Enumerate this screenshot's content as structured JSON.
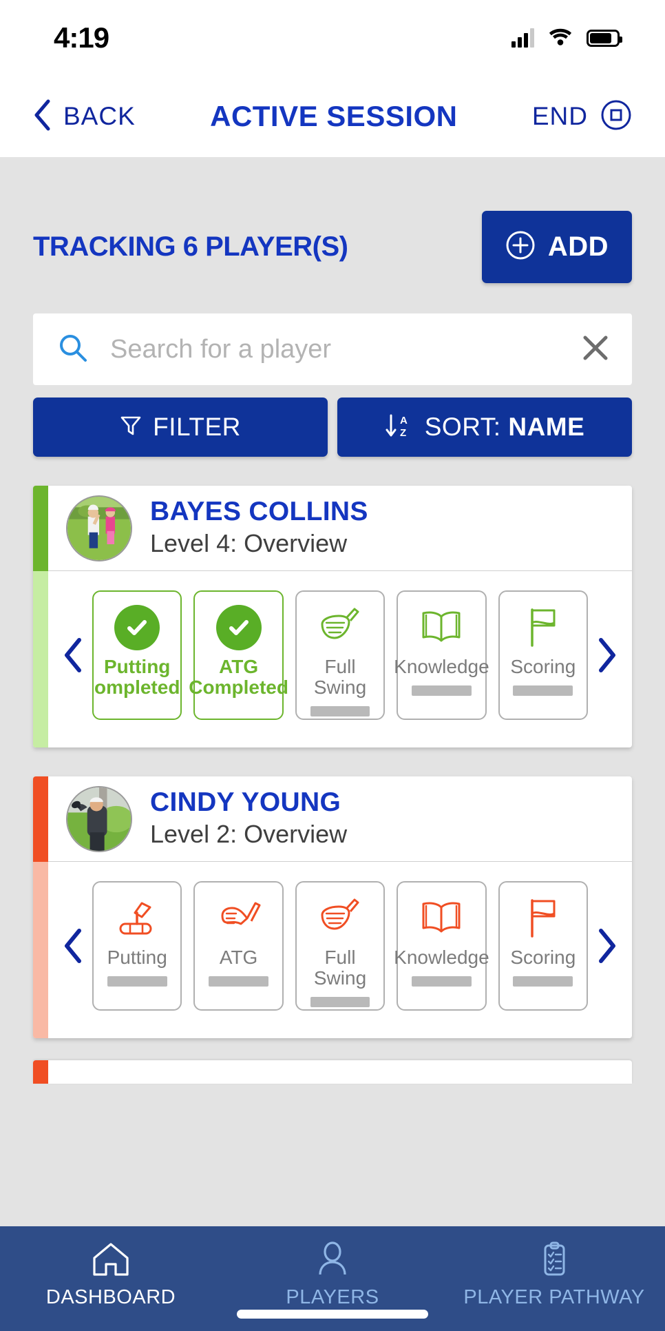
{
  "status_bar": {
    "time": "4:19",
    "signal_icon": "cellular-signal-icon",
    "wifi_icon": "wifi-icon",
    "battery_icon": "battery-icon"
  },
  "header": {
    "back_label": "BACK",
    "back_icon": "chevron-left-icon",
    "title": "ACTIVE SESSION",
    "end_label": "END",
    "end_icon": "stop-session-icon"
  },
  "tracking": {
    "title": "TRACKING 6 PLAYER(S)",
    "player_count": 6,
    "add_label": "ADD",
    "add_icon": "plus-circle-icon"
  },
  "search": {
    "placeholder": "Search for a player",
    "value": "",
    "search_icon": "search-icon",
    "clear_icon": "close-icon"
  },
  "controls": {
    "filter_label": "FILTER",
    "filter_icon": "funnel-icon",
    "sort_prefix": "SORT: ",
    "sort_value": "NAME",
    "sort_icon": "sort-az-icon"
  },
  "nav_arrows": {
    "prev_icon": "chevron-left-icon",
    "next_icon": "chevron-right-icon"
  },
  "colors": {
    "brand_blue": "#0f3399",
    "title_blue": "#1436c0",
    "green": "#6cb52d",
    "orange": "#f04e23",
    "nav_bar": "#2f4d88",
    "page_bg": "#e3e3e3"
  },
  "players": [
    {
      "name": "BAYES COLLINS",
      "level": "Level 4: Overview",
      "accent": "green",
      "accent_color": "#6cb52d",
      "accent_light": "#c6eda3",
      "avatar": "player-photo-bayes-collins",
      "skills": [
        {
          "label": "Putting\nompleted",
          "label_line1": "Putting",
          "label_line2": "ompleted",
          "icon": "check-circle-icon",
          "state": "completed"
        },
        {
          "label": "ATG\nCompleted",
          "label_line1": "ATG",
          "label_line2": "Completed",
          "icon": "check-circle-icon",
          "state": "completed"
        },
        {
          "label": "Full Swing",
          "label_line1": "Full Swing",
          "label_line2": "",
          "icon": "driver-icon",
          "state": "pending"
        },
        {
          "label": "Knowledge",
          "label_line1": "Knowledge",
          "label_line2": "",
          "icon": "book-icon",
          "state": "pending"
        },
        {
          "label": "Scoring",
          "label_line1": "Scoring",
          "label_line2": "",
          "icon": "flag-icon",
          "state": "pending"
        }
      ]
    },
    {
      "name": "CINDY YOUNG",
      "level": "Level 2: Overview",
      "accent": "orange",
      "accent_color": "#f04e23",
      "accent_light": "#f9b9a5",
      "avatar": "player-photo-cindy-young",
      "skills": [
        {
          "label": "Putting",
          "label_line1": "Putting",
          "label_line2": "",
          "icon": "putter-icon",
          "state": "pending"
        },
        {
          "label": "ATG",
          "label_line1": "ATG",
          "label_line2": "",
          "icon": "wedge-icon",
          "state": "pending"
        },
        {
          "label": "Full Swing",
          "label_line1": "Full Swing",
          "label_line2": "",
          "icon": "driver-icon",
          "state": "pending"
        },
        {
          "label": "Knowledge",
          "label_line1": "Knowledge",
          "label_line2": "",
          "icon": "book-icon",
          "state": "pending"
        },
        {
          "label": "Scoring",
          "label_line1": "Scoring",
          "label_line2": "",
          "icon": "flag-icon",
          "state": "pending"
        }
      ]
    }
  ],
  "bottom_nav": [
    {
      "label": "DASHBOARD",
      "icon": "home-icon",
      "active": true
    },
    {
      "label": "PLAYERS",
      "icon": "person-icon",
      "active": false
    },
    {
      "label": "PLAYER PATHWAY",
      "icon": "clipboard-checklist-icon",
      "active": false
    }
  ]
}
